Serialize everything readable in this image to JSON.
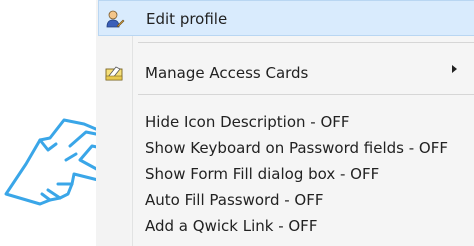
{
  "menu": {
    "items": [
      {
        "label": "Edit profile",
        "icon": "user-edit-icon",
        "highlighted": true
      },
      {
        "label": "Manage Access Cards",
        "icon": "access-card-icon",
        "submenu": true
      },
      {
        "label": "Hide Icon Description - OFF"
      },
      {
        "label": "Show Keyboard on Password fields - OFF"
      },
      {
        "label": "Show Form Fill dialog box - OFF"
      },
      {
        "label": "Auto Fill Password - OFF"
      },
      {
        "label": "Add a Qwick Link - OFF"
      }
    ]
  },
  "colors": {
    "highlight_bg": "#d9ebfd",
    "hand_stroke": "#3aa6e8",
    "menu_bg": "#f5f5f5"
  },
  "pointer": {
    "icon": "pointing-hand-icon"
  }
}
